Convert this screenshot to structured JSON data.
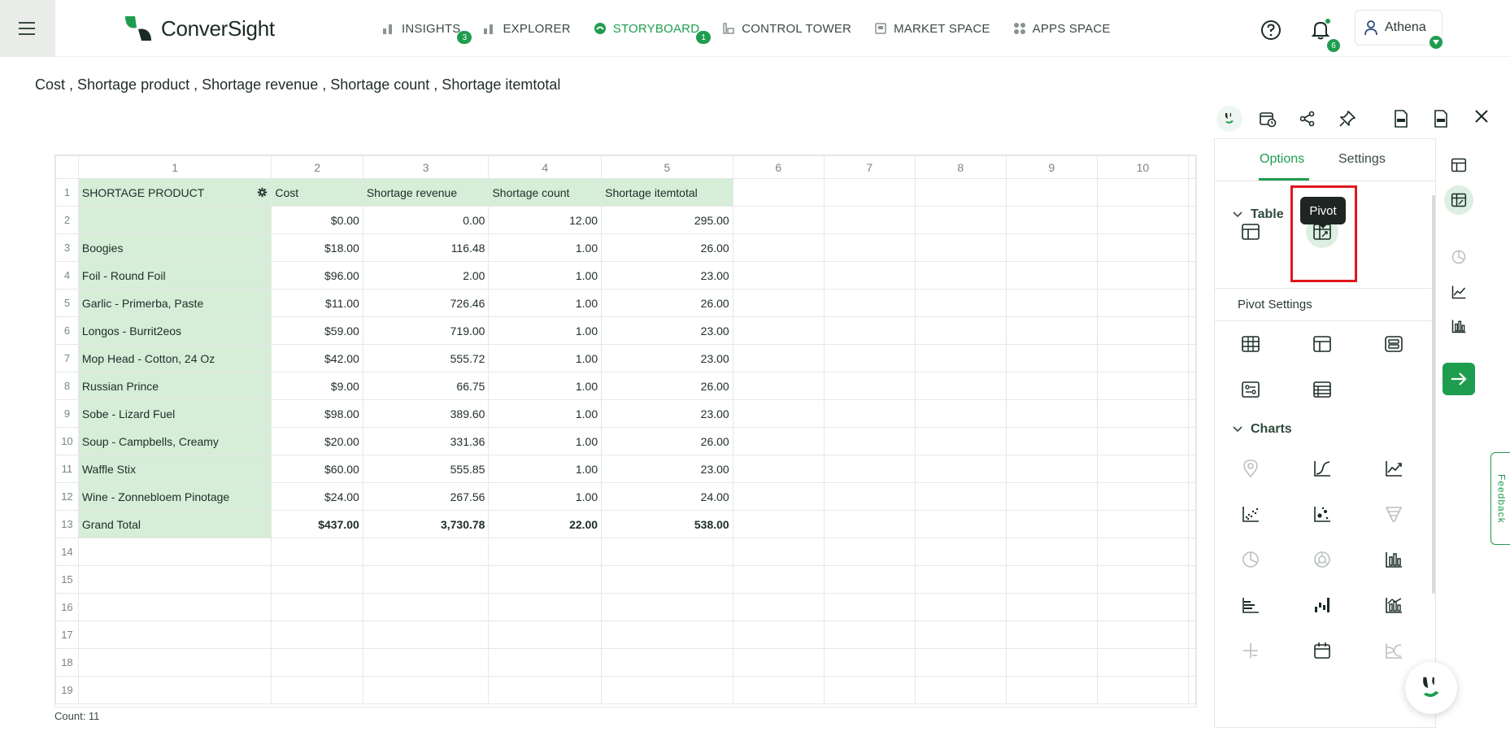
{
  "app": {
    "brand": "ConverSight",
    "nav": [
      {
        "label": "INSIGHTS",
        "badge": "3",
        "icon": "bar-chart-icon",
        "active": false
      },
      {
        "label": "EXPLORER",
        "badge": "",
        "icon": "bar-chart-icon",
        "active": false
      },
      {
        "label": "STORYBOARD",
        "badge": "1",
        "icon": "storyboard-icon",
        "active": true
      },
      {
        "label": "CONTROL TOWER",
        "badge": "",
        "icon": "tower-icon",
        "active": false
      },
      {
        "label": "MARKET SPACE",
        "badge": "",
        "icon": "market-icon",
        "active": false
      },
      {
        "label": "APPS SPACE",
        "badge": "",
        "icon": "apps-icon",
        "active": false
      }
    ],
    "notifications_count": "6",
    "user_name": "Athena",
    "accent_color": "#1f9d4f"
  },
  "page": {
    "title": "Cost , Shortage product , Shortage revenue , Shortage count , Shortage itemtotal",
    "count_label": "Count: 11"
  },
  "grid": {
    "col_headers": [
      "1",
      "2",
      "3",
      "4",
      "5",
      "6",
      "7",
      "8",
      "9",
      "10"
    ],
    "header_row": [
      "SHORTAGE PRODUCT",
      "Cost",
      "Shortage revenue",
      "Shortage count",
      "Shortage itemtotal"
    ],
    "rows": [
      [
        "",
        "$0.00",
        "0.00",
        "12.00",
        "295.00"
      ],
      [
        "Boogies",
        "$18.00",
        "116.48",
        "1.00",
        "26.00"
      ],
      [
        "Foil - Round Foil",
        "$96.00",
        "2.00",
        "1.00",
        "23.00"
      ],
      [
        "Garlic - Primerba, Paste",
        "$11.00",
        "726.46",
        "1.00",
        "26.00"
      ],
      [
        "Longos - Burrit2eos",
        "$59.00",
        "719.00",
        "1.00",
        "23.00"
      ],
      [
        "Mop Head - Cotton, 24 Oz",
        "$42.00",
        "555.72",
        "1.00",
        "23.00"
      ],
      [
        "Russian Prince",
        "$9.00",
        "66.75",
        "1.00",
        "26.00"
      ],
      [
        "Sobe - Lizard Fuel",
        "$98.00",
        "389.60",
        "1.00",
        "23.00"
      ],
      [
        "Soup - Campbells, Creamy",
        "$20.00",
        "331.36",
        "1.00",
        "26.00"
      ],
      [
        "Waffle Stix",
        "$60.00",
        "555.85",
        "1.00",
        "23.00"
      ],
      [
        "Wine - Zonnebloem Pinotage",
        "$24.00",
        "267.56",
        "1.00",
        "24.00"
      ]
    ],
    "total_row": [
      "Grand Total",
      "$437.00",
      "3,730.78",
      "22.00",
      "538.00"
    ],
    "row_numbers": [
      "1",
      "2",
      "3",
      "4",
      "5",
      "6",
      "7",
      "8",
      "9",
      "10",
      "11",
      "12",
      "13",
      "14",
      "15",
      "16",
      "17",
      "18",
      "19"
    ]
  },
  "panel": {
    "tabs": [
      "Options",
      "Settings"
    ],
    "active_tab": "Options",
    "table_section": "Table",
    "tooltip": "Pivot",
    "pivot_settings_label": "Pivot Settings",
    "charts_section": "Charts"
  },
  "feedback_label": "Feedback"
}
